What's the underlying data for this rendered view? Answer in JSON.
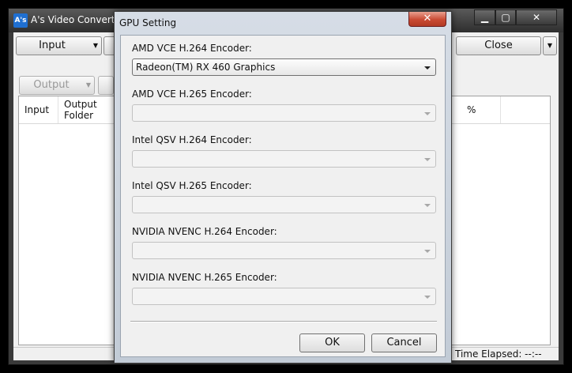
{
  "main_window": {
    "title": "A's Video Converter",
    "icon_text": "A's",
    "caption": {
      "minimize": "▁",
      "maximize": "▢",
      "close": "✕"
    },
    "toolbar": {
      "input_label": "Input",
      "close_label": "Close"
    },
    "output_label": "Output",
    "table": {
      "columns": [
        "Input",
        "Output\nFolder",
        "%"
      ]
    },
    "status": {
      "time_elapsed": "Time Elapsed: --:--"
    }
  },
  "dialog": {
    "title": "GPU Setting",
    "close_glyph": "✕",
    "encoders": [
      {
        "label": "AMD VCE H.264 Encoder:",
        "value": "Radeon(TM) RX 460 Graphics",
        "enabled": true
      },
      {
        "label": "AMD VCE H.265 Encoder:",
        "value": "",
        "enabled": false
      },
      {
        "label": "Intel QSV H.264 Encoder:",
        "value": "",
        "enabled": false
      },
      {
        "label": "Intel QSV H.265 Encoder:",
        "value": "",
        "enabled": false
      },
      {
        "label": "NVIDIA NVENC H.264 Encoder:",
        "value": "",
        "enabled": false
      },
      {
        "label": "NVIDIA NVENC H.265 Encoder:",
        "value": "",
        "enabled": false
      }
    ],
    "buttons": {
      "ok": "OK",
      "cancel": "Cancel"
    }
  }
}
